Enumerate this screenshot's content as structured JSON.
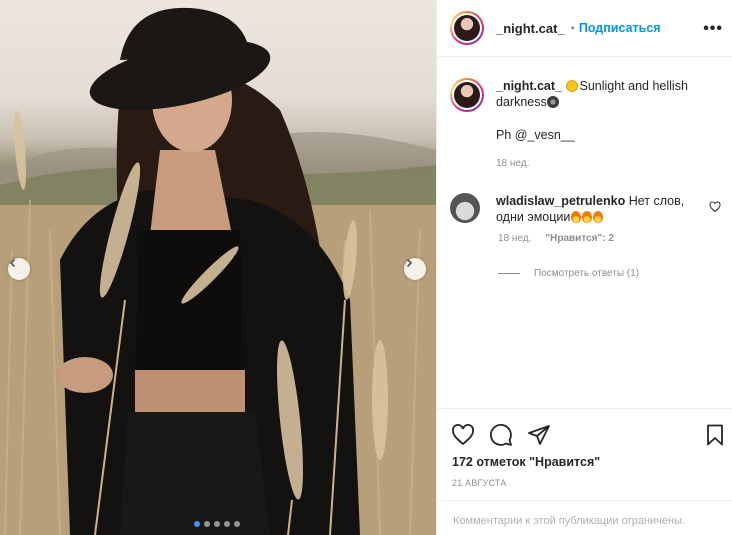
{
  "header": {
    "username": "_night.cat_",
    "separator": "•",
    "follow_label": "Подписаться",
    "more_label": "•••"
  },
  "caption": {
    "username": "_night.cat_",
    "text_part1": "Sunlight and hellish darkness",
    "credit": "Ph @_vesn__",
    "time": "18 нед."
  },
  "comment": {
    "username": "wladislaw_petrulenko",
    "text": "Нет слов, одни эмоции",
    "time": "18 нед.",
    "likes": "\"Нравится\": 2",
    "view_replies": "Посмотреть ответы (1)"
  },
  "post": {
    "likes": "172 отметок \"Нравится\"",
    "date": "21 АВГУСТА",
    "comments_disabled": "Комментарии к этой публикации ограничены."
  },
  "carousel": {
    "total": 5,
    "active": 0
  },
  "colors": {
    "link": "#0095f6",
    "muted": "#8e8e8e",
    "text": "#262626",
    "border": "#efefef"
  },
  "icons": {
    "like": "heart-icon",
    "comment": "comment-icon",
    "share": "paper-plane-icon",
    "save": "bookmark-icon",
    "prev": "chevron-left-icon",
    "next": "chevron-right-icon"
  }
}
